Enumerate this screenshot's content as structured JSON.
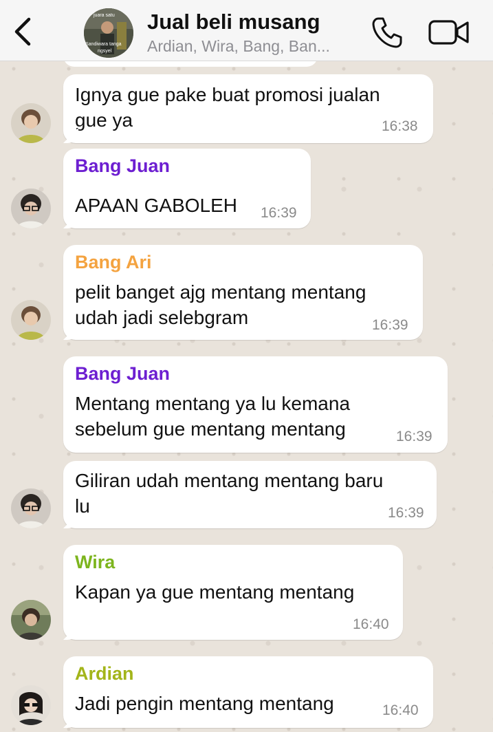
{
  "header": {
    "title": "Jual beli musang",
    "subtitle": "Ardian, Wira, Bang, Ban...",
    "avatar_text_top": "juara satu",
    "avatar_text_mid": "Sandiwara tanga",
    "avatar_text_bot": "ngsyel"
  },
  "colors": {
    "bang_juan": "#6d1fd1",
    "bang_ari": "#f4a340",
    "wira": "#7db51e",
    "ardian": "#a3b51a"
  },
  "messages": [
    {
      "sender": "",
      "text": "Ignya gue pake buat promosi jualan\ngue ya",
      "time": "16:38",
      "avatar": "avatar-green-shirt"
    },
    {
      "sender": "Bang Juan",
      "text": "APAAN GABOLEH",
      "time": "16:39",
      "avatar": "avatar-glasses"
    },
    {
      "sender": "Bang Ari",
      "text": "pelit banget ajg mentang mentang\nudah jadi selebgram",
      "time": "16:39",
      "avatar": "avatar-green-shirt"
    },
    {
      "sender": "Bang Juan",
      "text": "Mentang mentang ya lu kemana\nsebelum gue mentang mentang",
      "time": "16:39",
      "avatar": ""
    },
    {
      "sender": "",
      "text": "Giliran udah mentang mentang baru\nlu",
      "time": "16:39",
      "avatar": "avatar-glasses"
    },
    {
      "sender": "Wira",
      "text": "Kapan ya gue mentang mentang",
      "time": "16:40",
      "avatar": "avatar-outdoor"
    },
    {
      "sender": "Ardian",
      "text": "Jadi pengin mentang mentang",
      "time": "16:40",
      "avatar": "avatar-dark-hair"
    }
  ]
}
